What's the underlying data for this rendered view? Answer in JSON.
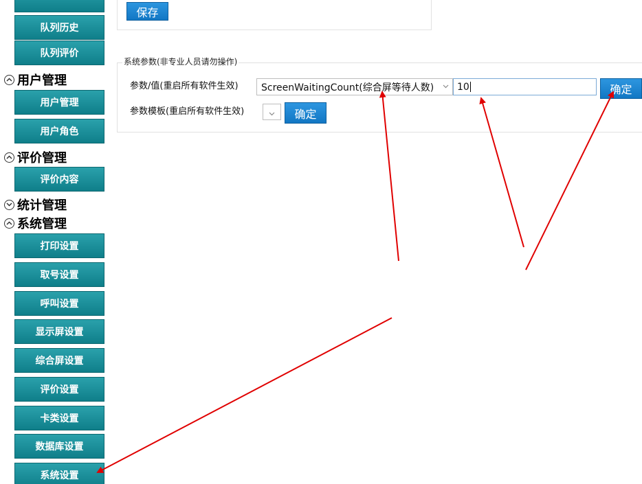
{
  "sidebar": {
    "queue_history": "队列历史",
    "queue_evaluation": "队列评价",
    "groups": {
      "user_mgmt": "用户管理",
      "eval_mgmt": "评价管理",
      "stats_mgmt": "统计管理",
      "system_mgmt": "系统管理"
    },
    "user_items": [
      "用户管理",
      "用户角色"
    ],
    "eval_items": [
      "评价内容"
    ],
    "system_items": [
      "打印设置",
      "取号设置",
      "呼叫设置",
      "显示屏设置",
      "综合屏设置",
      "评价设置",
      "卡类设置",
      "数据库设置",
      "系统设置"
    ]
  },
  "top_panel": {
    "save_label": "保存"
  },
  "system_params": {
    "legend": "系统参数(非专业人员请勿操作)",
    "param_value_label": "参数/值(重启所有软件生效)",
    "param_selected": "ScreenWaitingCount(综合屏等待人数)",
    "value_input": "10",
    "confirm_label": "确定",
    "template_label": "参数模板(重启所有软件生效)",
    "template_confirm_label": "确定"
  },
  "colors": {
    "nav_button": "#1a8e99",
    "action_button": "#1b84d0",
    "annotation_arrow": "#e00000"
  }
}
